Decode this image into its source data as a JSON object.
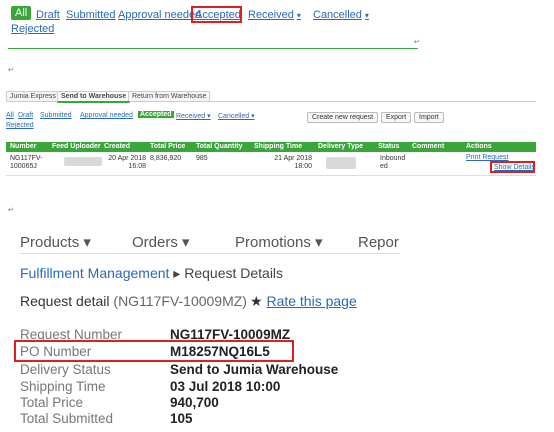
{
  "panel1": {
    "tabs": [
      {
        "label": "All",
        "active": true
      },
      {
        "label": "Draft"
      },
      {
        "label": "Submitted"
      },
      {
        "label": "Approval needed"
      },
      {
        "label": "Accepted",
        "highlighted": true
      },
      {
        "label": "Received",
        "dropdown": true
      },
      {
        "label": "Cancelled",
        "dropdown": true
      },
      {
        "label": "Rejected"
      }
    ],
    "caret": "▾",
    "mark": "↵"
  },
  "panel2": {
    "tabs": [
      "Jumia Express",
      "Send to Warehouse",
      "Return from Warehouse"
    ],
    "active_tab": "Send to Warehouse",
    "filters": [
      "All",
      "Draft",
      "Submitted",
      "Approval needed",
      "Accepted",
      "Received ▾",
      "Cancelled ▾",
      "Rejected"
    ],
    "buttons": [
      "Create new request",
      "Export",
      "Import"
    ],
    "columns": [
      "Number",
      "Feed Uploader",
      "Created",
      "Total Price",
      "Total Quantity",
      "Shipping Time",
      "Delivery Type",
      "Status",
      "Comment",
      "Actions"
    ],
    "row": {
      "number": "NG117FV-100065J",
      "created": "20 Apr 2018 16:08",
      "total_price": "8,836,920",
      "total_quantity": "985",
      "shipping_time": "21 Apr 2018 18:00",
      "status": "Inbound ed",
      "actions": [
        "Print Request",
        "Show Details"
      ]
    },
    "mark": "↵",
    "accent": "#3aa63a"
  },
  "panel3": {
    "nav": [
      "Products ▾",
      "Orders ▾",
      "Promotions ▾",
      "Repor"
    ],
    "breadcrumb": {
      "parent": "Fulfillment Management",
      "separator": "▸",
      "current": "Request Details"
    },
    "title": "Request detail",
    "title_sub": "(NG117FV-10009MZ)",
    "rate_star": "★",
    "rate_label": "Rate this page",
    "details": [
      {
        "label": "Request Number",
        "value": "NG117FV-10009MZ"
      },
      {
        "label": "PO Number",
        "value": "M18257NQ16L5",
        "highlighted": true
      },
      {
        "label": "Delivery Status",
        "value": "Send to Jumia Warehouse"
      },
      {
        "label": "Shipping Time",
        "value": "03 Jul 2018 10:00"
      },
      {
        "label": "Total Price",
        "value": "940,700"
      },
      {
        "label": "Total Submitted",
        "value": "105"
      }
    ]
  },
  "colors": {
    "accent_green": "#3aa63a",
    "link_blue": "#2a6ab8",
    "highlight_red": "#e02020"
  }
}
